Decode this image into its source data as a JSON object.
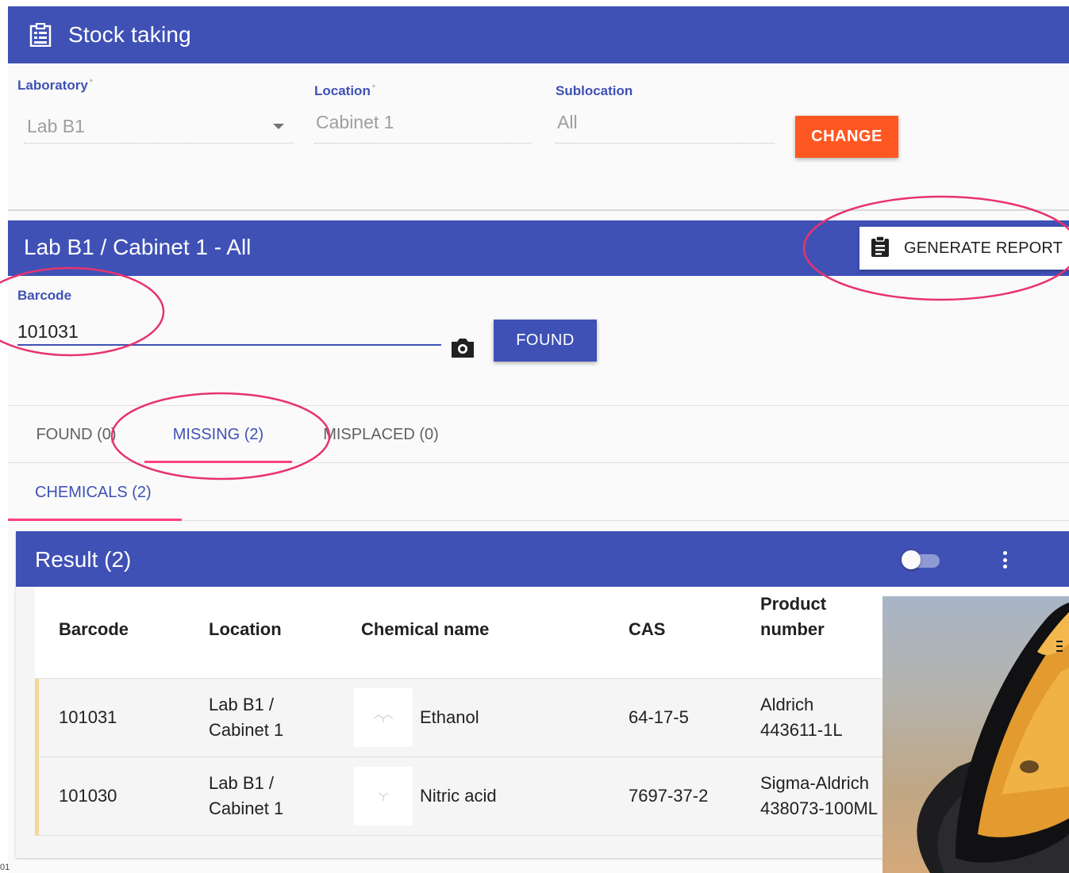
{
  "topbar": {
    "title": "Stock taking",
    "icon": "clipboard-list-icon"
  },
  "filters": {
    "laboratory": {
      "label": "Laboratory",
      "required": "*",
      "value": "Lab B1"
    },
    "location": {
      "label": "Location",
      "required": "*",
      "value": "Cabinet 1"
    },
    "sublocation": {
      "label": "Sublocation",
      "value": "All"
    },
    "change_label": "CHANGE"
  },
  "section": {
    "title": "Lab B1 / Cabinet 1 - All",
    "report_label": "GENERATE REPORT"
  },
  "barcode": {
    "label": "Barcode",
    "value": "101031",
    "found_label": "FOUND"
  },
  "tabs": [
    {
      "label": "FOUND (0)",
      "active": false
    },
    {
      "label": "MISSING (2)",
      "active": true
    },
    {
      "label": "MISPLACED (0)",
      "active": false
    }
  ],
  "subtabs": [
    {
      "label": "CHEMICALS (2)",
      "active": true
    }
  ],
  "result": {
    "title": "Result (2)",
    "columns": [
      "Barcode",
      "Location",
      "Chemical name",
      "CAS",
      "Product number"
    ],
    "rows": [
      {
        "barcode": "101031",
        "location": "Lab B1 / Cabinet 1",
        "location_line1": "Lab B1 /",
        "location_line2": "Cabinet 1",
        "chemical": "Ethanol",
        "cas": "64-17-5",
        "product_line1": "Aldrich",
        "product_line2": "443611-1L"
      },
      {
        "barcode": "101030",
        "location": "Lab B1 / Cabinet 1",
        "location_line1": "Lab B1 /",
        "location_line2": "Cabinet 1",
        "chemical": "Nitric acid",
        "cas": "7697-37-2",
        "product_line1": "Sigma-Aldrich",
        "product_line2": "438073-100ML"
      }
    ]
  },
  "footnote": "01",
  "colors": {
    "primary": "#3f51b5",
    "accent": "#ff5722",
    "tab_indicator": "#ff4081",
    "annotation": "#e8336d",
    "row_marker": "#f2d798"
  }
}
